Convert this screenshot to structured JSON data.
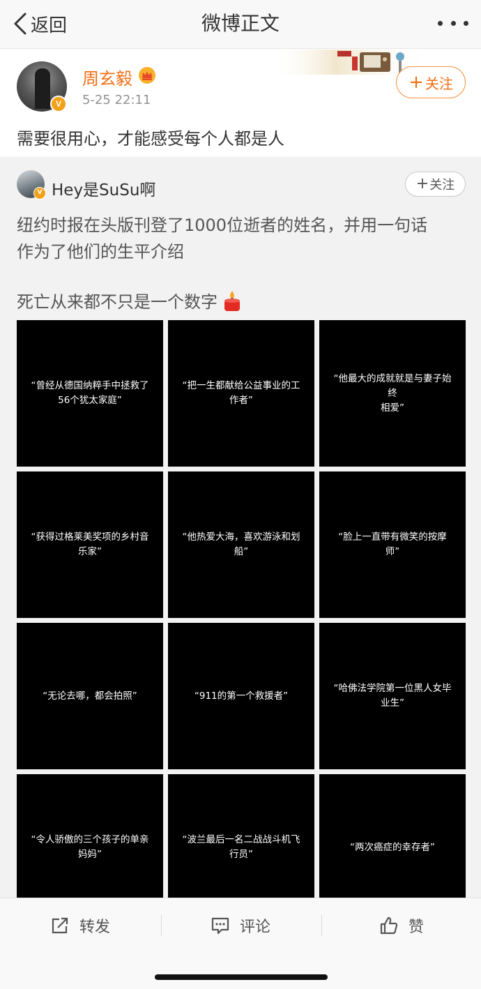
{
  "nav": {
    "back_label": "返回",
    "title": "微博正文"
  },
  "post": {
    "author": "周玄毅",
    "verified_badge": "V",
    "time": "5-25 22:11",
    "follow_label": "关注",
    "text": "需要很用心，才能感受每个人都是人"
  },
  "repost": {
    "author": "Hey是SuSu啊",
    "follow_label": "关注",
    "text_lines": [
      "纽约时报在头版刊登了1000位逝者的姓名，并用一句话",
      "作为了他们的生平介绍",
      "死亡从来都不只是一个数字"
    ],
    "emoji": "candle-emoji",
    "images": [
      [
        "“曾经从德国纳粹手中拯救了",
        "56个犹太家庭”"
      ],
      [
        "“把一生都献给公益事业的工",
        "作者”"
      ],
      [
        "“他最大的成就就是与妻子始终",
        "相爱”"
      ],
      [
        "“获得过格莱美奖项的乡村音",
        "乐家”"
      ],
      [
        "“他热爱大海，喜欢游泳和划",
        "船”"
      ],
      [
        "“脸上一直带有微笑的按摩",
        "师”"
      ],
      [
        "“无论去哪，都会拍照”"
      ],
      [
        "“911的第一个救援者”"
      ],
      [
        "“哈佛法学院第一位黑人女毕",
        "业生”"
      ],
      [
        "“令人骄傲的三个孩子的单亲",
        "妈妈”"
      ],
      [
        "“波兰最后一名二战战斗机飞",
        "行员”"
      ],
      [
        "“两次癌症的幸存者”"
      ]
    ]
  },
  "actions": {
    "repost_label": "转发",
    "comment_label": "评论",
    "like_label": "赞"
  },
  "colors": {
    "accent": "#f36e14",
    "follow_border": "#f89140",
    "badge": "#f4a11a"
  }
}
